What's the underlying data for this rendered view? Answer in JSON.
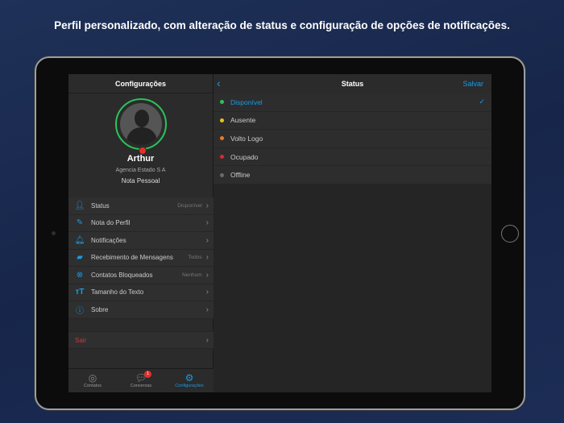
{
  "caption": "Perfil personalizado, com alteração de status e configuração de opções de notificações.",
  "left": {
    "title": "Configurações",
    "profile": {
      "name": "Arthur",
      "company": "Agencia Estado S A",
      "note": "Nota Pessoal"
    },
    "menu": [
      {
        "label": "Status",
        "value": "Disponível",
        "icon": "person-icon"
      },
      {
        "label": "Nota do Perfil",
        "value": "",
        "icon": "edit-note-icon"
      },
      {
        "label": "Notificações",
        "value": "",
        "icon": "bell-icon"
      },
      {
        "label": "Recebimento de Mensagens",
        "value": "Todos",
        "icon": "chat-bubbles-icon"
      },
      {
        "label": "Contatos Bloqueados",
        "value": "Nenhum",
        "icon": "blocked-icon"
      },
      {
        "label": "Tamanho do Texto",
        "value": "",
        "icon": "text-size-icon"
      },
      {
        "label": "Sobre",
        "value": "",
        "icon": "info-icon"
      }
    ],
    "logout": "Sair",
    "tabs": [
      {
        "label": "Contatos"
      },
      {
        "label": "Conversas",
        "badge": "1"
      },
      {
        "label": "Configurações"
      }
    ]
  },
  "right": {
    "title": "Status",
    "save": "Salvar",
    "options": [
      {
        "label": "Disponível",
        "color": "#2fc25b",
        "selected": true
      },
      {
        "label": "Ausente",
        "color": "#e8c21f"
      },
      {
        "label": "Volto Logo",
        "color": "#e8792a"
      },
      {
        "label": "Ocupado",
        "color": "#d8283a"
      },
      {
        "label": "Offline",
        "color": "#6a6a6a"
      }
    ]
  },
  "colors": {
    "accent": "#1a9be6",
    "danger": "#d0383a"
  }
}
